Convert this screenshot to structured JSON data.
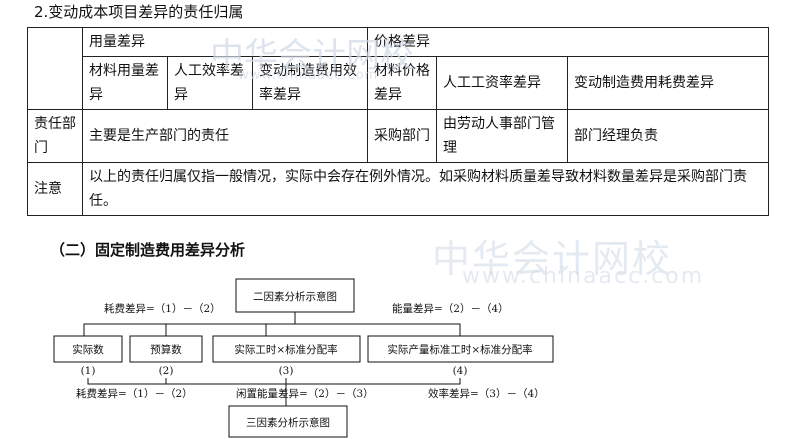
{
  "heading": "2.变动成本项目差异的责任归属",
  "table": {
    "qty_variance": "用量差异",
    "price_variance": "价格差异",
    "material_qty": "材料用量差异",
    "labor_eff": "人工效率差异",
    "moh_eff": "变动制造费用效率差异",
    "material_price": "材料价格差异",
    "labor_rate": "人工工资率差异",
    "moh_spend": "变动制造费用耗费差异",
    "resp_label": "责任部门",
    "resp_qty": "主要是生产部门的责任",
    "resp_purchase": "采购部门",
    "resp_hr": "由劳动人事部门管理",
    "resp_mgr": "部门经理负责",
    "note_label": "注意",
    "note_text": "以上的责任归属仅指一般情况，实际中会存在例外情况。如采购材料质量差导致材料数量差异是采购部门责任。"
  },
  "watermark": {
    "cn": "中华会计网校",
    "url": "www.chinaacc.com"
  },
  "subheading": "（二）固定制造费用差异分析",
  "diagram": {
    "top_box": "二因素分析示意图",
    "left_label": "耗费差异=（1）－（2）",
    "right_label": "能量差异=（2）－（4）",
    "boxes": [
      "实际数",
      "预算数",
      "实际工时×标准分配率",
      "实际产量标准工时×标准分配率"
    ],
    "nums": [
      "(1)",
      "(2)",
      "(3)",
      "(4)"
    ],
    "bottom_left": "耗费差异=（1）－（2）",
    "bottom_mid": "闲置能量差异=（2）－（3）",
    "bottom_right": "效率差异=（3）－（4）",
    "bottom_box": "三因素分析示意图"
  }
}
